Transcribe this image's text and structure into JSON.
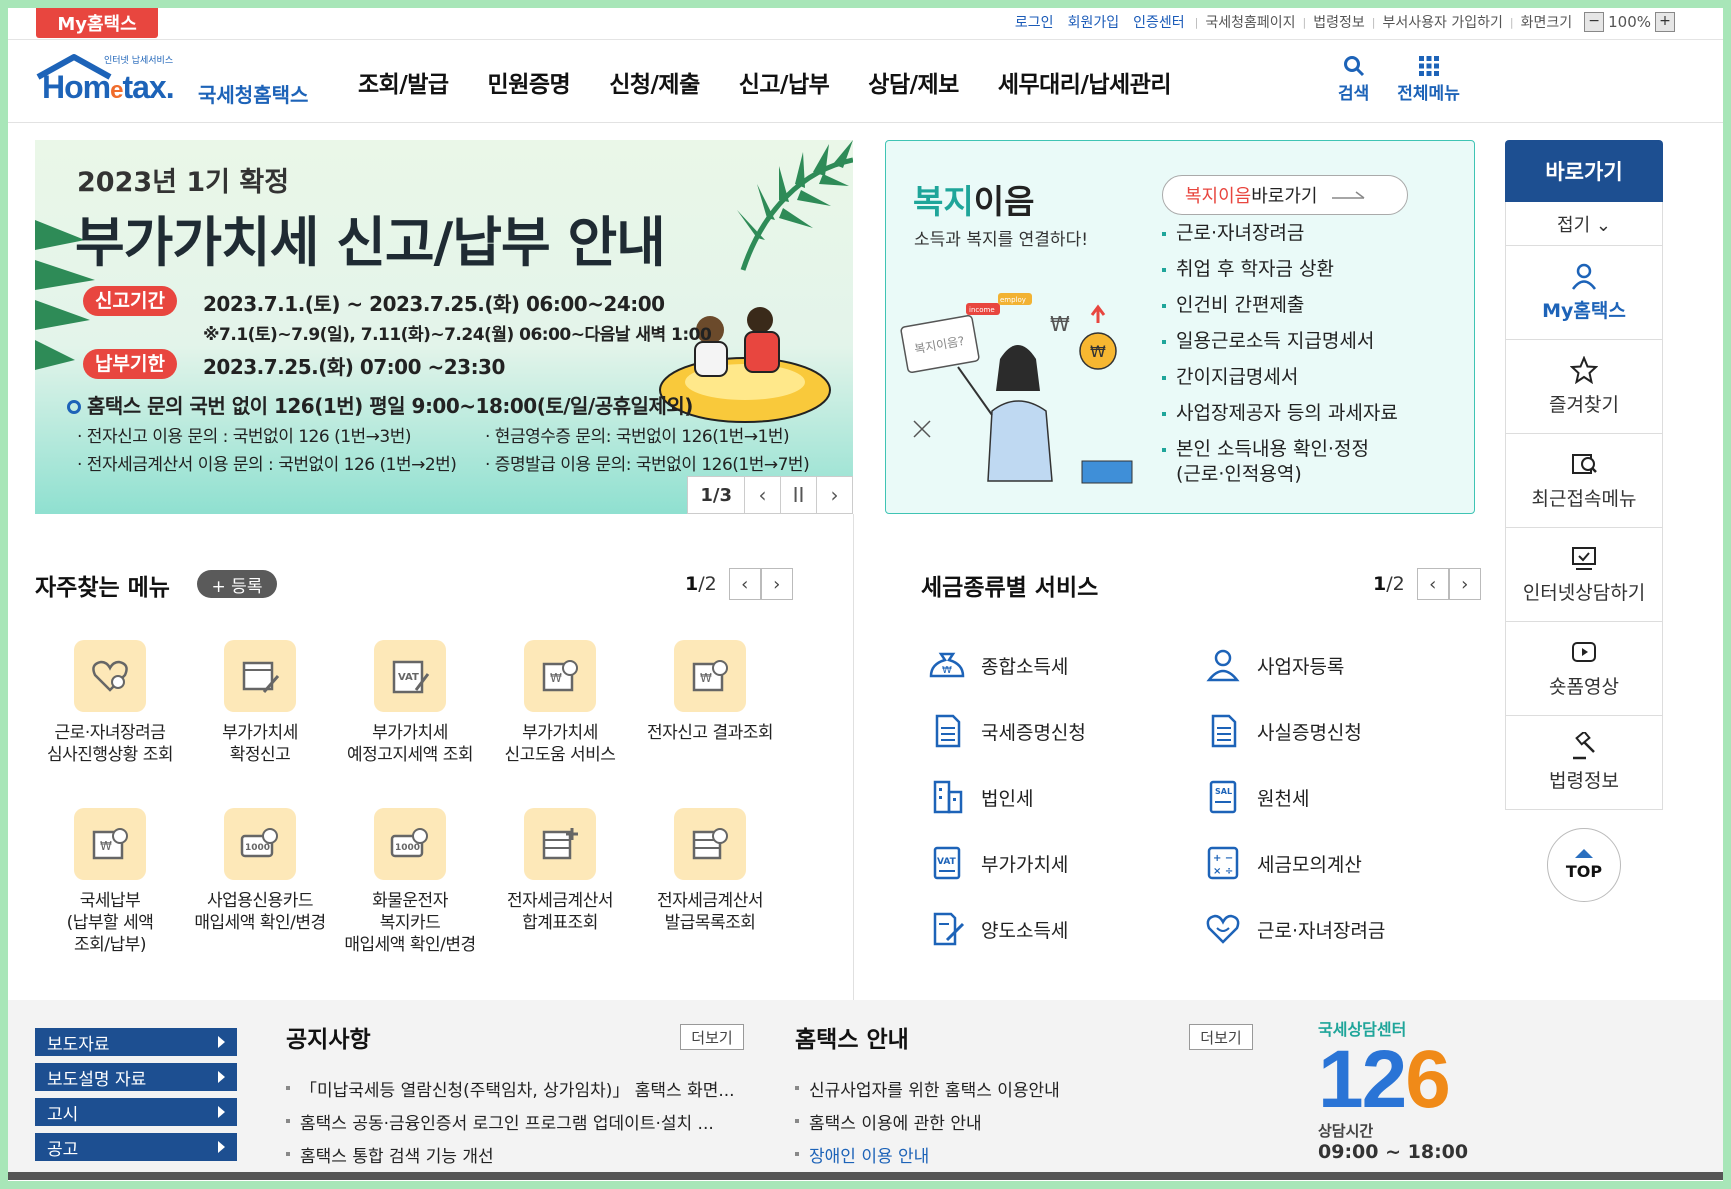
{
  "topbar": {
    "my_badge": "My홈택스",
    "links": [
      "로그인",
      "회원가입",
      "인증센터"
    ],
    "gray_links": [
      "국세청홈페이지",
      "법령정보",
      "부서사용자 가입하기",
      "화면크기"
    ],
    "zoom_minus": "−",
    "zoom_value": "100%",
    "zoom_plus": "+"
  },
  "header": {
    "logo_small": "인터넷 납세서비스",
    "logo_home": "Hom",
    "logo_e": "e",
    "logo_tax": "tax.",
    "logo_kname": "국세청홈택스",
    "menus": [
      "조회/발급",
      "민원증명",
      "신청/제출",
      "신고/납부",
      "상담/제보",
      "세무대리/납세관리"
    ],
    "search_label": "검색",
    "all_menu_label": "전체메뉴"
  },
  "banner": {
    "subtitle": "2023년 1기 확정",
    "title": "부가가치세 신고/납부 안내",
    "pill1": "신고기간",
    "period1": "2023.7.1.(토) ~ 2023.7.25.(화) 06:00~24:00",
    "period1_note": "※7.1(토)~7.9(일), 7.11(화)~7.24(월) 06:00~다음날 새벽 1:00",
    "pill2": "납부기한",
    "period2": "2023.7.25.(화) 07:00 ~23:30",
    "inquiry": "홈택스 문의 국번 없이 126(1번) 평일 9:00~18:00(토/일/공휴일제외)",
    "detail1": "· 전자신고 이용 문의 : 국번없이 126 (1번→3번)",
    "detail2": "· 현금영수증 문의: 국번없이 126(1번→1번)",
    "detail3": "· 전자세금계산서 이용 문의 : 국번없이 126 (1번→2번)",
    "detail4": "· 증명발급 이용 문의: 국번없이 126(1번→7번)",
    "page": "1/3",
    "prev": "‹",
    "pause": "II",
    "next": "›"
  },
  "welfare": {
    "title_a": "복지",
    "title_b": "이음",
    "desc": "소득과 복지를 연결하다!",
    "go_r": "복지이음",
    "go_b": " 바로가기",
    "items": [
      "근로·자녀장려금",
      "취업 후 학자금 상환",
      "인건비 간편제출",
      "일용근로소득 지급명세서",
      "간이지급명세서",
      "사업장제공자 등의 과세자료",
      "본인 소득내용 확인·정정",
      "(근로·인적용역)"
    ],
    "ill_bubble": "복지이음?",
    "ill_tag1": "employ",
    "ill_tag2": "income"
  },
  "quick": {
    "head": "바로가기",
    "fold": "접기 ⌄",
    "items": [
      "My홈택스",
      "즐겨찾기",
      "최근접속메뉴",
      "인터넷상담하기",
      "숏폼영상",
      "법령정보"
    ],
    "top": "TOP"
  },
  "freq": {
    "title": "자주찾는 메뉴",
    "register": "+ 등록",
    "page_cur": "1",
    "page_tot": "/2",
    "prev": "‹",
    "next": "›",
    "items": [
      "근로·자녀장려금\n심사진행상황 조회",
      "부가가치세\n확정신고",
      "부가가치세\n예정고지세액 조회",
      "부가가치세\n신고도움 서비스",
      "전자신고 결과조회",
      "국세납부\n(납부할 세액\n조회/납부)",
      "사업용신용카드\n매입세액 확인/변경",
      "화물운전자\n복지카드\n매입세액 확인/변경",
      "전자세금계산서\n합계표조회",
      "전자세금계산서\n발급목록조회"
    ]
  },
  "taxsvc": {
    "title": "세금종류별 서비스",
    "page_cur": "1",
    "page_tot": "/2",
    "prev": "‹",
    "next": "›",
    "items": [
      "종합소득세",
      "사업자등록",
      "국세증명신청",
      "사실증명신청",
      "법인세",
      "원천세",
      "부가가치세",
      "세금모의계산",
      "양도소득세",
      "근로·자녀장려금"
    ]
  },
  "footer": {
    "nav": [
      "보도자료",
      "보도설명 자료",
      "고시",
      "공고"
    ],
    "notice_title": "공지사항",
    "notice_more": "더보기",
    "notices": [
      "「미납국세등 열람신청(주택임차, 상가임차)」 홈택스 화면...",
      "홈택스 공동·금융인증서 로그인 프로그램 업데이트·설치 ...",
      "홈택스 통합 검색 기능 개선"
    ],
    "guide_title": "홈택스 안내",
    "guide_more": "더보기",
    "guides": [
      "신규사업자를 위한 홈택스 이용안내",
      "홈택스 이용에 관한 안내",
      "장애인 이용 안내"
    ],
    "center_label": "국세상담센터",
    "center_1": "1",
    "center_2": "2",
    "center_6": "6",
    "center_time_label": "상담시간",
    "center_time": "09:00 ~ 18:00"
  }
}
